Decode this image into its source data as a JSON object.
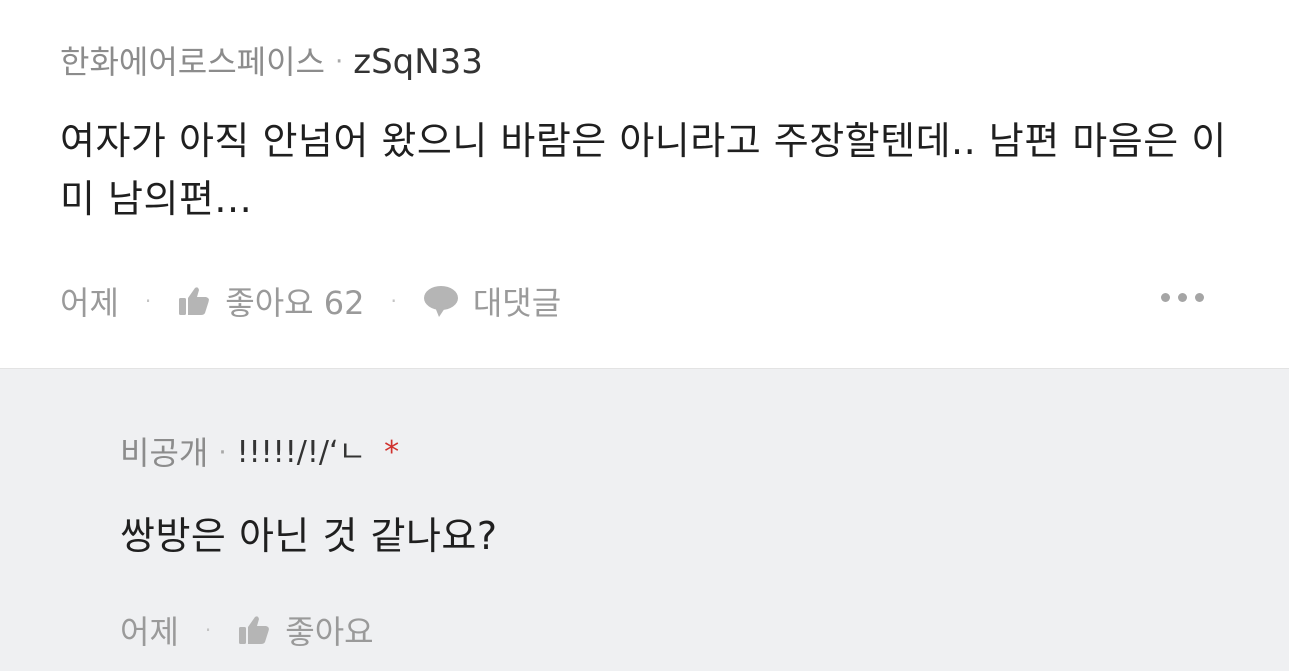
{
  "comment": {
    "affiliation": "한화에어로스페이스",
    "separator": "·",
    "user_id": "zSqN33",
    "text": "여자가 아직 안넘어 왔으니 바람은 아니라고 주장할텐데.. 남편 마음은 이미 남의편...",
    "time": "어제",
    "like_label": "좋아요 62",
    "reply_label": "대댓글",
    "dot_sep": "·",
    "icons": {
      "like": "thumbs-up-icon",
      "reply": "speech-bubble-icon",
      "more": "more-dots-icon"
    }
  },
  "reply": {
    "affiliation": "비공개",
    "separator": "·",
    "user_id": "!!!!!/!/‘ㄴ",
    "author_marker": "*",
    "text": "쌍방은 아닌 것 같나요?",
    "time": "어제",
    "like_label": "좋아요",
    "dot_sep": "·",
    "icons": {
      "like": "thumbs-up-icon"
    }
  },
  "colors": {
    "reply_background": "#eff0f2",
    "author_marker": "#d0312d",
    "meta_text": "#9a9a9a"
  }
}
